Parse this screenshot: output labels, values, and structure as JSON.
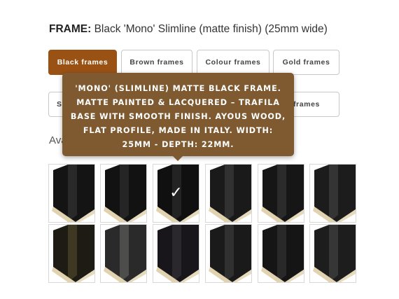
{
  "header": {
    "label": "FRAME:",
    "value": "Black 'Mono' Slimline (matte finish) (25mm wide)"
  },
  "tabs_row1": [
    {
      "label": "Black frames",
      "active": true
    },
    {
      "label": "Brown frames",
      "active": false
    },
    {
      "label": "Colour frames",
      "active": false
    },
    {
      "label": "Gold frames",
      "active": false
    }
  ],
  "tabs_row2": [
    {
      "label": "S",
      "active": false
    },
    {
      "label": "frames",
      "active": false
    }
  ],
  "available_text": "Ava",
  "tooltip": {
    "text": "'MONO' (SLIMLINE) MATTE BLACK FRAME. MATTE PAINTED & LACQUERED – TRAFILA BASE WITH SMOOTH FINISH. AYOUS WOOD, FLAT PROFILE, MADE IN ITALY. WIDTH: 25MM - DEPTH: 22MM."
  },
  "selected_check": "✓",
  "swatches": [
    {
      "row": 1,
      "finish": "black-matte",
      "color": "#141414",
      "highlight": "#3a3a3a",
      "selected": false
    },
    {
      "row": 1,
      "finish": "black-matte",
      "color": "#121212",
      "highlight": "#353535",
      "selected": false
    },
    {
      "row": 1,
      "finish": "black-matte",
      "color": "#101010",
      "highlight": "#333333",
      "selected": true
    },
    {
      "row": 1,
      "finish": "black-textured",
      "color": "#1a1a1a",
      "highlight": "#454545",
      "selected": false
    },
    {
      "row": 1,
      "finish": "black-stepped",
      "color": "#161616",
      "highlight": "#3e3e3e",
      "selected": false
    },
    {
      "row": 1,
      "finish": "black-grain",
      "color": "#1c1c1c",
      "highlight": "#484848",
      "selected": false
    },
    {
      "row": 2,
      "finish": "black-gold-distressed",
      "color": "#1e1b14",
      "highlight": "#5a5030",
      "selected": false
    },
    {
      "row": 2,
      "finish": "black-silver-distressed",
      "color": "#2a2a2a",
      "highlight": "#6a6a66",
      "selected": false
    },
    {
      "row": 2,
      "finish": "black-rounded",
      "color": "#18161a",
      "highlight": "#3c383e",
      "selected": false
    },
    {
      "row": 2,
      "finish": "black-textured",
      "color": "#1a1a1a",
      "highlight": "#444444",
      "selected": false
    },
    {
      "row": 2,
      "finish": "black-satin",
      "color": "#151515",
      "highlight": "#3a3a3a",
      "selected": false
    },
    {
      "row": 2,
      "finish": "black-grain",
      "color": "#1d1d1d",
      "highlight": "#4a4a4a",
      "selected": false
    }
  ],
  "colors": {
    "accent": "#9a5214",
    "tooltip_bg": "#7f5a30",
    "wood": "#e2d3b0"
  }
}
